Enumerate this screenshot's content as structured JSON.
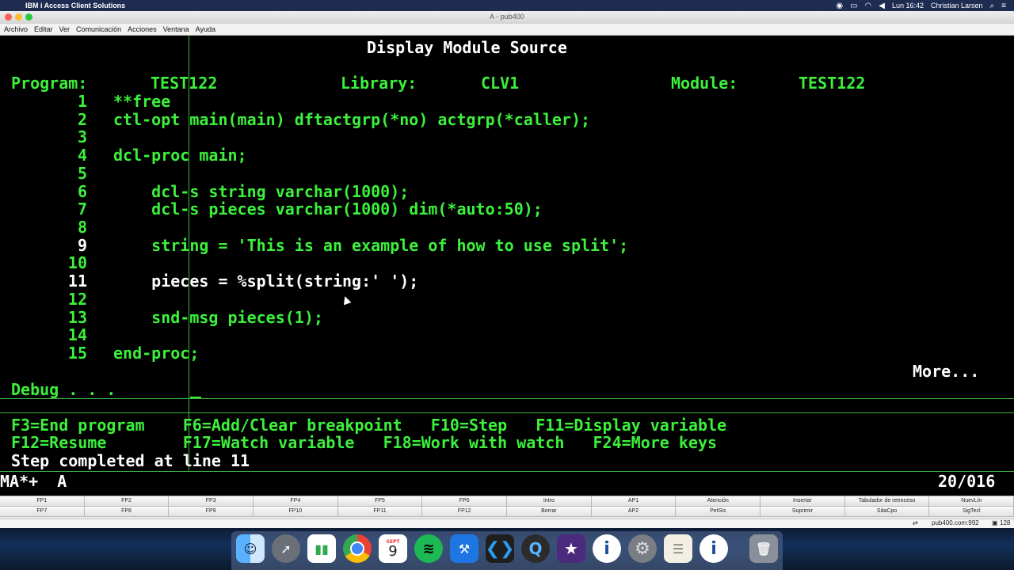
{
  "mac_menubar": {
    "app_name": "IBM i Access Client Solutions",
    "clock": "Lun 16:42",
    "user": "Christian Larsen"
  },
  "window": {
    "title": "A - pub400"
  },
  "app_menu": [
    "Archivo",
    "Editar",
    "Ver",
    "Comunicación",
    "Acciones",
    "Ventana",
    "Ayuda"
  ],
  "terminal": {
    "screen_title": "Display Module Source",
    "header": {
      "program_label": "Program:",
      "program_value": "TEST122",
      "library_label": "Library:",
      "library_value": "CLV1",
      "module_label": "Module:",
      "module_value": "TEST122"
    },
    "source_lines": [
      {
        "num": "1",
        "code": "**free"
      },
      {
        "num": "2",
        "code": "ctl-opt main(main) dftactgrp(*no) actgrp(*caller);"
      },
      {
        "num": "3",
        "code": ""
      },
      {
        "num": "4",
        "code": "dcl-proc main;"
      },
      {
        "num": "5",
        "code": ""
      },
      {
        "num": "6",
        "code": "    dcl-s string varchar(1000);"
      },
      {
        "num": "7",
        "code": "    dcl-s pieces varchar(1000) dim(*auto:50);"
      },
      {
        "num": "8",
        "code": ""
      },
      {
        "num": "9",
        "code": "    string = 'This is an example of how to use split';"
      },
      {
        "num": "10",
        "code": ""
      },
      {
        "num": "11",
        "code": "    pieces = %split(string:' ');"
      },
      {
        "num": "12",
        "code": ""
      },
      {
        "num": "13",
        "code": "    snd-msg pieces(1);"
      },
      {
        "num": "14",
        "code": ""
      },
      {
        "num": "15",
        "code": "end-proc;"
      }
    ],
    "more": "More...",
    "debug_label": "Debug . . .",
    "fkeys_line1": "F3=End program    F6=Add/Clear breakpoint   F10=Step   F11=Display variable",
    "fkeys_line2": "F12=Resume        F17=Watch variable   F18=Work with watch   F24=More keys",
    "message": "Step completed at line 11",
    "status_left": "MA*+  A",
    "status_right": "20/016"
  },
  "function_keys": {
    "row1": [
      "FP1",
      "FP2",
      "FP3",
      "FP4",
      "FP5",
      "FP6",
      "Intro",
      "AP1",
      "Atención",
      "Insertar",
      "Tabulador de retroceso",
      "NuevLín"
    ],
    "row2": [
      "FP7",
      "FP8",
      "FP9",
      "FP10",
      "FP11",
      "FP12",
      "Borrar",
      "AP2",
      "PetSis",
      "Suprimir",
      "SdaCpo",
      "SigTecl"
    ]
  },
  "connection": {
    "host": "pub400.com:992",
    "count": "128"
  },
  "dock": {
    "calendar_month": "SEPT",
    "calendar_day": "9",
    "apps": [
      "finder-icon",
      "launchpad-icon",
      "numbers-icon",
      "chrome-icon",
      "calendar-icon",
      "spotify-icon",
      "xcode-icon",
      "vscode-icon",
      "quicktime-icon",
      "imovie-icon",
      "ibm-i-acs-icon",
      "system-preferences-icon",
      "notes-icon",
      "ibm-i-icon",
      "trash-icon"
    ]
  },
  "colors": {
    "green": "#3cf03c",
    "white": "#ffffff",
    "background": "#000000",
    "menubar": "#1e2c52"
  }
}
